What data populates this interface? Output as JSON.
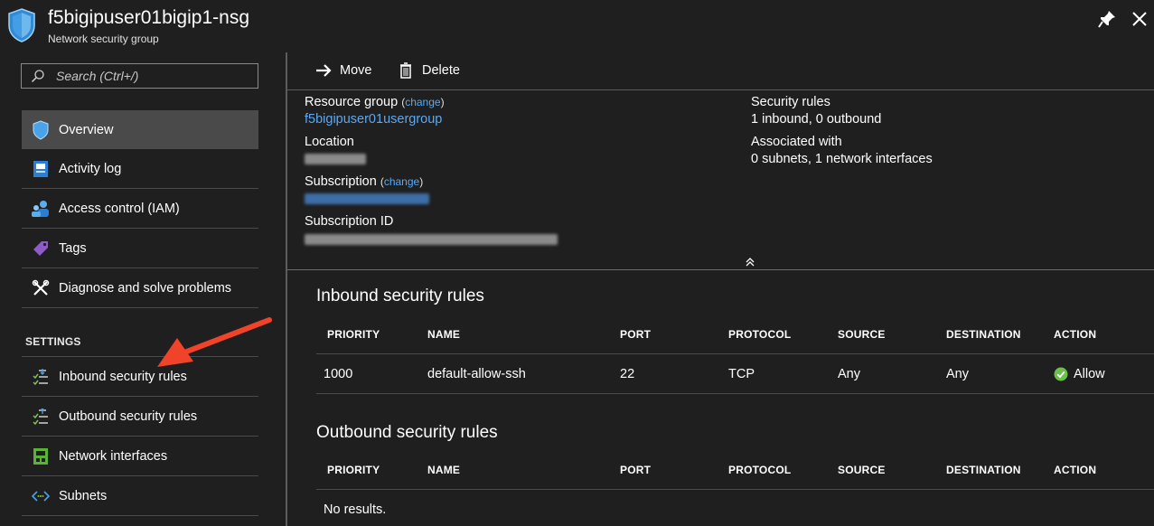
{
  "header": {
    "title": "f5bigipuser01bigip1-nsg",
    "subtitle": "Network security group"
  },
  "sidebar": {
    "search_placeholder": "Search (Ctrl+/)",
    "items": [
      {
        "label": "Overview",
        "icon": "shield-icon",
        "active": true
      },
      {
        "label": "Activity log",
        "icon": "activity-log-icon"
      },
      {
        "label": "Access control (IAM)",
        "icon": "users-icon"
      },
      {
        "label": "Tags",
        "icon": "tag-icon"
      },
      {
        "label": "Diagnose and solve problems",
        "icon": "wrench-icon"
      }
    ],
    "settings_header": "SETTINGS",
    "settings_items": [
      {
        "label": "Inbound security rules",
        "icon": "inbound-rules-icon"
      },
      {
        "label": "Outbound security rules",
        "icon": "outbound-rules-icon"
      },
      {
        "label": "Network interfaces",
        "icon": "network-interface-icon"
      },
      {
        "label": "Subnets",
        "icon": "subnet-icon"
      }
    ]
  },
  "toolbar": {
    "move_label": "Move",
    "delete_label": "Delete"
  },
  "essentials": {
    "resource_group_label": "Resource group",
    "change_label": "change",
    "resource_group_value": "f5bigipuser01usergroup",
    "location_label": "Location",
    "subscription_label": "Subscription",
    "subscription_id_label": "Subscription ID",
    "security_rules_label": "Security rules",
    "security_rules_value": "1 inbound, 0 outbound",
    "associated_label": "Associated with",
    "associated_value": "0 subnets, 1 network interfaces"
  },
  "inbound": {
    "title": "Inbound security rules",
    "columns": [
      "PRIORITY",
      "NAME",
      "PORT",
      "PROTOCOL",
      "SOURCE",
      "DESTINATION",
      "ACTION"
    ],
    "rows": [
      {
        "priority": "1000",
        "name": "default-allow-ssh",
        "port": "22",
        "protocol": "TCP",
        "source": "Any",
        "destination": "Any",
        "action": "Allow"
      }
    ]
  },
  "outbound": {
    "title": "Outbound security rules",
    "columns": [
      "PRIORITY",
      "NAME",
      "PORT",
      "PROTOCOL",
      "SOURCE",
      "DESTINATION",
      "ACTION"
    ],
    "empty_text": "No results."
  },
  "colors": {
    "background": "#1f1f1f",
    "link": "#5aa9f5",
    "active_item": "#4a4a4a",
    "allow_green": "#6cc04a",
    "arrow_red": "#f0432a"
  }
}
